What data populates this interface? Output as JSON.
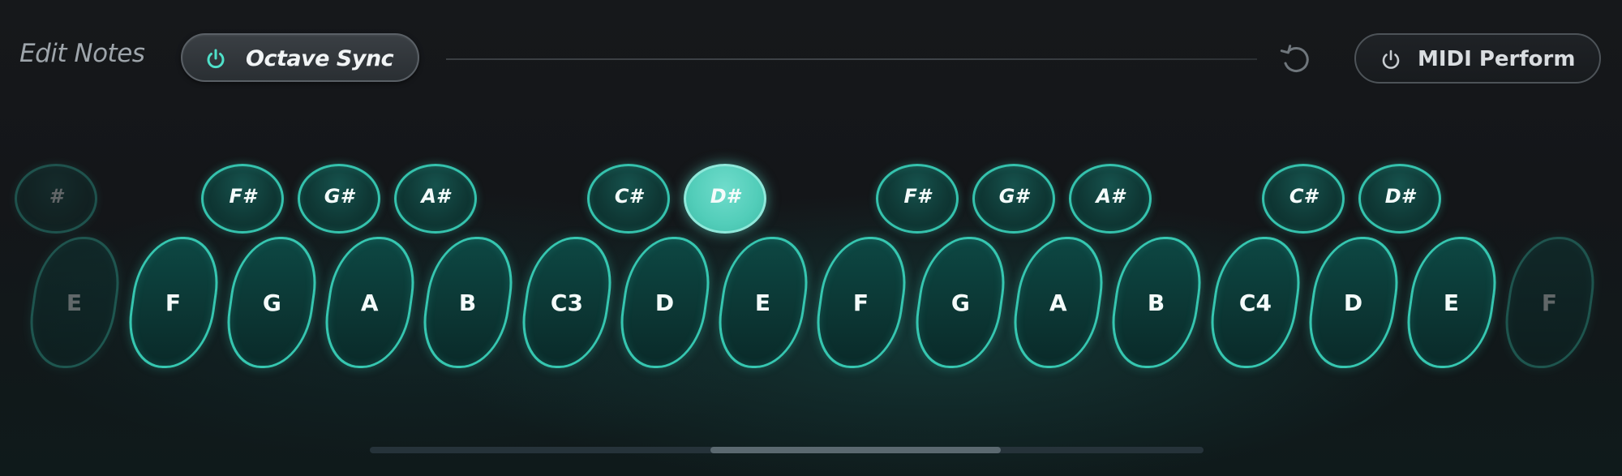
{
  "header": {
    "edit_label": "Edit Notes",
    "octave_sync_label": "Octave Sync",
    "octave_sync_on": true,
    "midi_perform_label": "MIDI Perform",
    "midi_perform_on": false,
    "accent_color": "#35c2ad",
    "undo_icon": "undo-icon",
    "power_icon": "power-icon"
  },
  "keyboard": {
    "sharps": [
      {
        "label": "#",
        "active": false,
        "faded": true
      },
      {
        "label": "F#",
        "active": false,
        "faded": false
      },
      {
        "label": "G#",
        "active": false,
        "faded": false
      },
      {
        "label": "A#",
        "active": false,
        "faded": false
      },
      {
        "label": "C#",
        "active": false,
        "faded": false
      },
      {
        "label": "D#",
        "active": true,
        "faded": false
      },
      {
        "label": "F#",
        "active": false,
        "faded": false
      },
      {
        "label": "G#",
        "active": false,
        "faded": false
      },
      {
        "label": "A#",
        "active": false,
        "faded": false
      },
      {
        "label": "C#",
        "active": false,
        "faded": false
      },
      {
        "label": "D#",
        "active": false,
        "faded": false
      }
    ],
    "naturals": [
      {
        "label": "E",
        "faded": true
      },
      {
        "label": "F",
        "faded": false
      },
      {
        "label": "G",
        "faded": false
      },
      {
        "label": "A",
        "faded": false
      },
      {
        "label": "B",
        "faded": false
      },
      {
        "label": "C3",
        "faded": false
      },
      {
        "label": "D",
        "faded": false
      },
      {
        "label": "E",
        "faded": false
      },
      {
        "label": "F",
        "faded": false
      },
      {
        "label": "G",
        "faded": false
      },
      {
        "label": "A",
        "faded": false
      },
      {
        "label": "B",
        "faded": false
      },
      {
        "label": "C4",
        "faded": false
      },
      {
        "label": "D",
        "faded": false
      },
      {
        "label": "E",
        "faded": false
      },
      {
        "label": "F",
        "faded": true
      }
    ]
  },
  "scroll": {
    "position": 0.41
  }
}
